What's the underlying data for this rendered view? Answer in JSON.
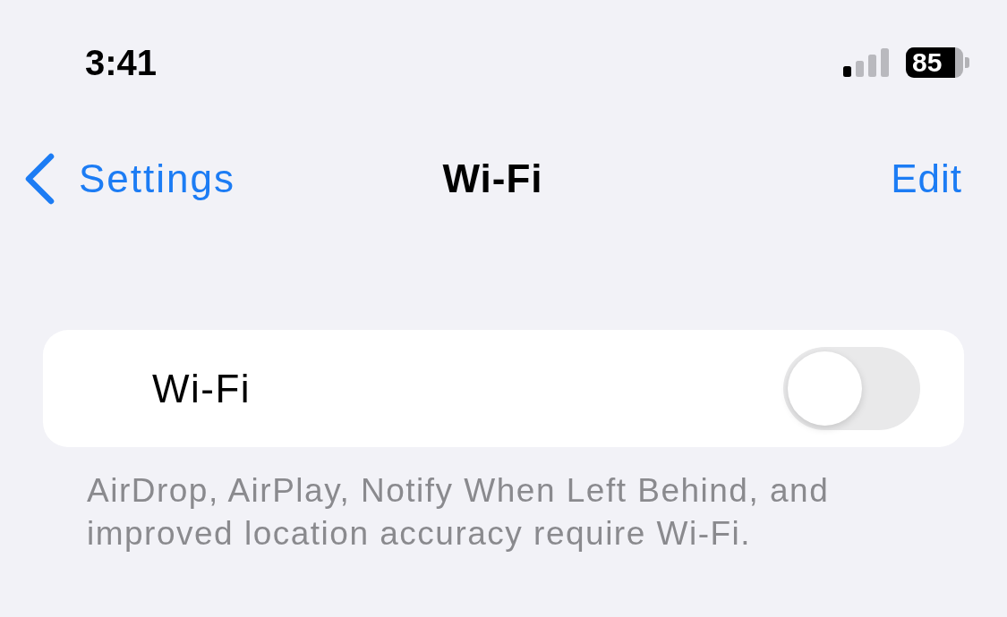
{
  "status_bar": {
    "time": "3:41",
    "battery": "85"
  },
  "nav_bar": {
    "back": "Settings",
    "title": "Wi-Fi",
    "action": "Edit"
  },
  "settings": [
    {
      "label": "Wi-Fi",
      "kind": "toggle",
      "on": false
    }
  ],
  "footer": "AirDrop, AirPlay, Notify When Left Behind, and improved location accuracy require Wi-Fi."
}
